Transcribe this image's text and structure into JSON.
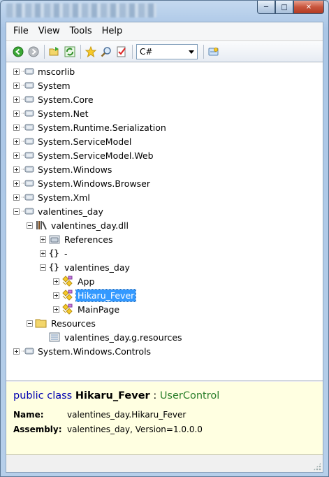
{
  "menu": {
    "items": [
      {
        "label": "File"
      },
      {
        "label": "View"
      },
      {
        "label": "Tools"
      },
      {
        "label": "Help"
      }
    ]
  },
  "toolbar": {
    "icons": [
      "back-icon",
      "forward-icon",
      "open-icon",
      "refresh-icon",
      "favorite-star-icon",
      "search-icon",
      "checklist-icon",
      "web-search-icon"
    ],
    "language": "C#"
  },
  "tree": {
    "nodes": [
      {
        "label": "mscorlib",
        "icon": "assembly-icon",
        "expander": "plus"
      },
      {
        "label": "System",
        "icon": "assembly-icon",
        "expander": "plus"
      },
      {
        "label": "System.Core",
        "icon": "assembly-icon",
        "expander": "plus"
      },
      {
        "label": "System.Net",
        "icon": "assembly-icon",
        "expander": "plus"
      },
      {
        "label": "System.Runtime.Serialization",
        "icon": "assembly-icon",
        "expander": "plus"
      },
      {
        "label": "System.ServiceModel",
        "icon": "assembly-icon",
        "expander": "plus"
      },
      {
        "label": "System.ServiceModel.Web",
        "icon": "assembly-icon",
        "expander": "plus"
      },
      {
        "label": "System.Windows",
        "icon": "assembly-icon",
        "expander": "plus"
      },
      {
        "label": "System.Windows.Browser",
        "icon": "assembly-icon",
        "expander": "plus"
      },
      {
        "label": "System.Xml",
        "icon": "assembly-icon",
        "expander": "plus"
      },
      {
        "label": "valentines_day",
        "icon": "assembly-icon",
        "expander": "minus"
      },
      {
        "label": "valentines_day.dll",
        "icon": "module-icon",
        "expander": "minus"
      },
      {
        "label": "References",
        "icon": "references-icon",
        "expander": "plus"
      },
      {
        "label": "-",
        "icon": "namespace-icon",
        "expander": "plus"
      },
      {
        "label": "valentines_day",
        "icon": "namespace-icon",
        "expander": "minus"
      },
      {
        "label": "App",
        "icon": "class-icon",
        "expander": "plus"
      },
      {
        "label": "Hikaru_Fever",
        "icon": "class-icon",
        "expander": "plus",
        "selected": true
      },
      {
        "label": "MainPage",
        "icon": "class-icon",
        "expander": "plus"
      },
      {
        "label": "Resources",
        "icon": "folder-icon",
        "expander": "minus"
      },
      {
        "label": "valentines_day.g.resources",
        "icon": "resource-file-icon",
        "expander": "none"
      },
      {
        "label": "System.Windows.Controls",
        "icon": "assembly-icon",
        "expander": "plus"
      }
    ]
  },
  "details": {
    "keyword": "public class",
    "name": "Hikaru_Fever",
    "separator": ":",
    "base": "UserControl",
    "name_label": "Name:",
    "name_value": "valentines_day.Hikaru_Fever",
    "assembly_label": "Assembly:",
    "assembly_value": "valentines_day, Version=1.0.0.0"
  },
  "colors": {
    "selection": "#3399ff",
    "details_background": "#ffffe1",
    "keyword": "#0000b0",
    "base_type": "#2b7f2b"
  }
}
